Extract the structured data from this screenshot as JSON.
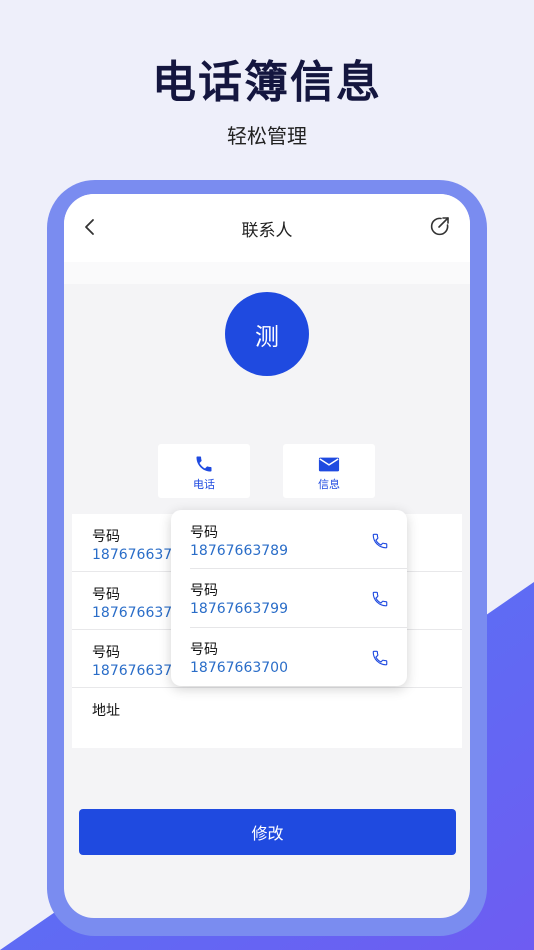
{
  "hero": {
    "title": "电话簿信息",
    "subtitle": "轻松管理"
  },
  "nav": {
    "title": "联系人",
    "back_icon": "chevron-left-icon",
    "share_icon": "share-icon"
  },
  "contact": {
    "avatar_text": "测"
  },
  "actions": [
    {
      "label": "电话",
      "icon": "phone-icon"
    },
    {
      "label": "信息",
      "icon": "mail-icon"
    }
  ],
  "fields": [
    {
      "label": "号码",
      "value": "1876766378"
    },
    {
      "label": "号码",
      "value": "1876766379"
    },
    {
      "label": "号码",
      "value": "1876766370"
    },
    {
      "label": "地址",
      "value": ""
    }
  ],
  "popup": {
    "items": [
      {
        "label": "号码",
        "number": "18767663789"
      },
      {
        "label": "号码",
        "number": "18767663799"
      },
      {
        "label": "号码",
        "number": "18767663700"
      }
    ]
  },
  "edit_button": {
    "label": "修改"
  },
  "colors": {
    "accent": "#1f4ae0",
    "link": "#2a6dc8",
    "phone_frame": "#7a8cf0",
    "background": "#eeeffa",
    "corner_gradient": [
      "#6e5cf2",
      "#4f7bf5"
    ]
  }
}
